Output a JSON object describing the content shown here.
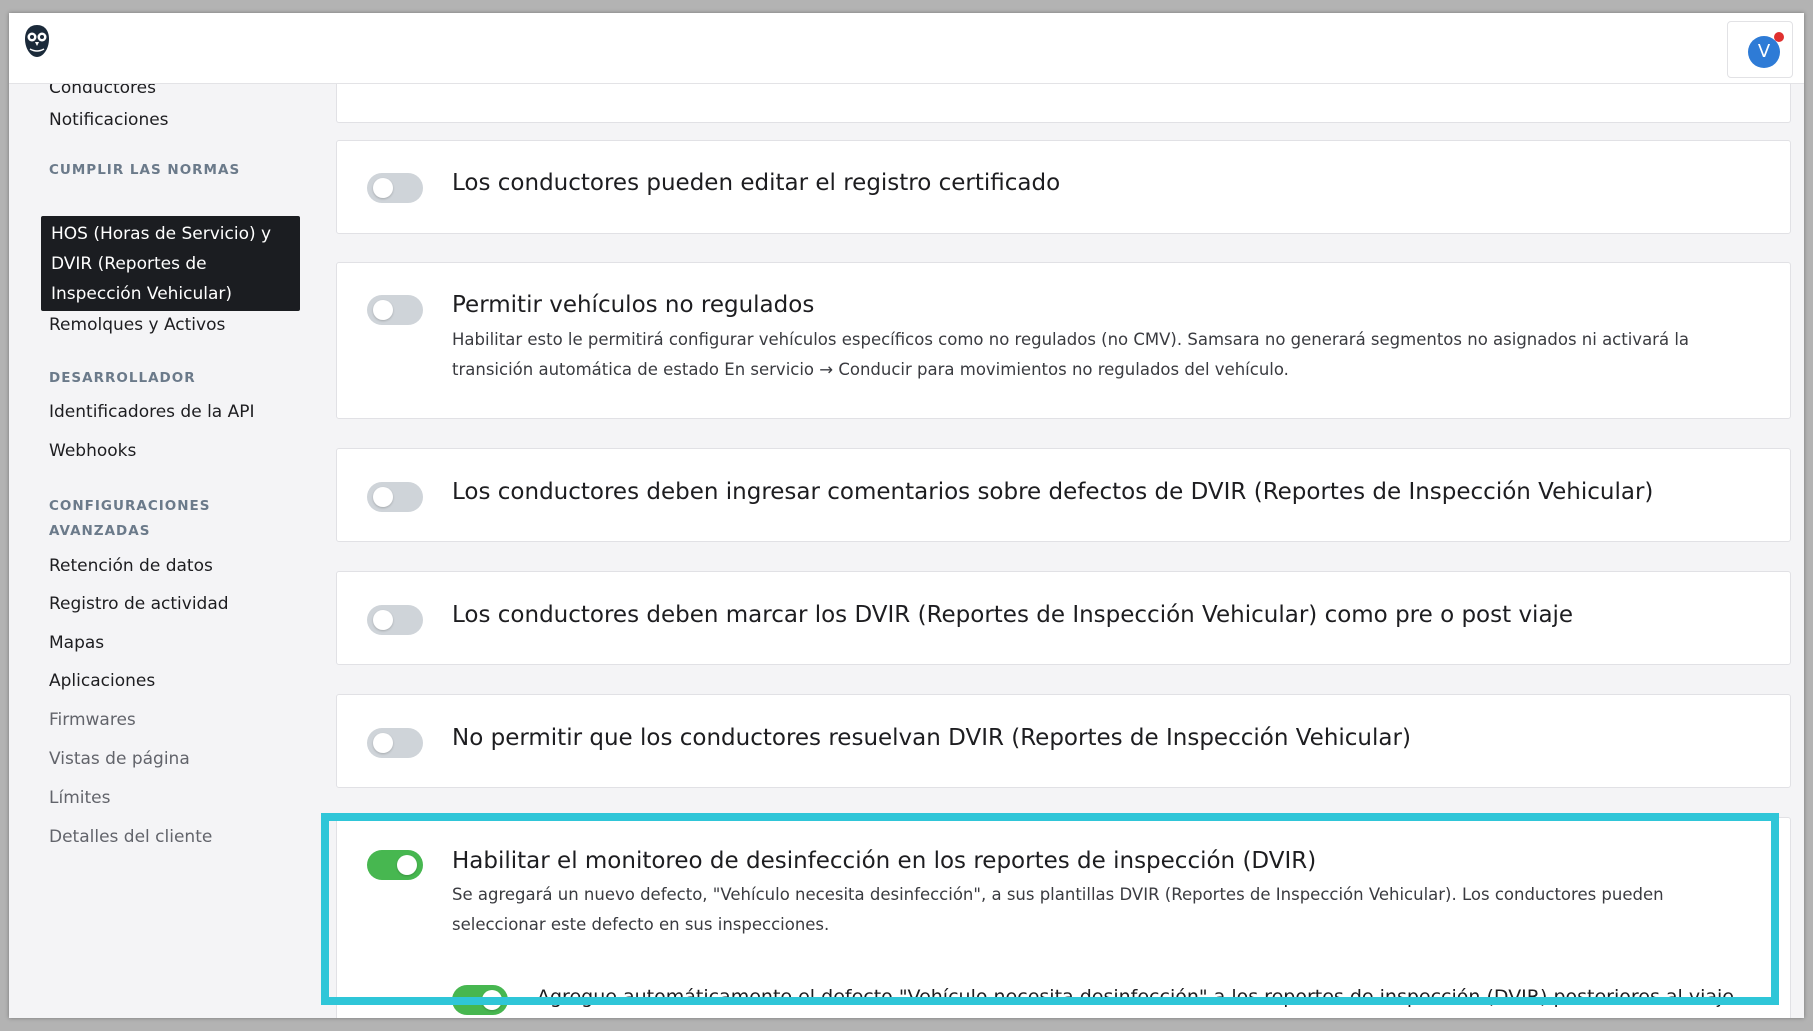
{
  "colors": {
    "accent_highlight": "#2fc6d8",
    "toggle_on": "#47b750",
    "toggle_off": "#cfd4d9",
    "avatar": "#2e7bd6",
    "notification_dot": "#e0302f"
  },
  "header": {
    "avatar_initial": "V"
  },
  "sidebar": {
    "items_top": [
      "Conductores",
      "Notificaciones"
    ],
    "section_compliance": "CUMPLIR LAS NORMAS",
    "active_item": "HOS (Horas de Servicio) y DVIR (Reportes de Inspección Vehicular)",
    "item_trailers": "Remolques y Activos",
    "section_developer": "DESARROLLADOR",
    "item_api": "Identificadores de la API",
    "item_webhooks": "Webhooks",
    "section_advanced": "CONFIGURACIONES AVANZADAS",
    "item_retention": "Retención de datos",
    "item_activity": "Registro de actividad",
    "item_maps": "Mapas",
    "item_apps": "Aplicaciones",
    "item_firmwares": "Firmwares",
    "item_pageviews": "Vistas de página",
    "item_limits": "Límites",
    "item_customer": "Detalles del cliente"
  },
  "settings": [
    {
      "title": "Los conductores pueden editar el registro certificado",
      "enabled": false
    },
    {
      "title": "Permitir vehículos no regulados",
      "description": "Habilitar esto le permitirá configurar vehículos específicos como no regulados (no CMV). Samsara no generará segmentos no asignados ni activará la transición automática de estado En servicio → Conducir para movimientos no regulados del vehículo.",
      "enabled": false
    },
    {
      "title": "Los conductores deben ingresar comentarios sobre defectos de DVIR (Reportes de Inspección Vehicular)",
      "enabled": false
    },
    {
      "title": "Los conductores deben marcar los DVIR (Reportes de Inspección Vehicular) como pre o post viaje",
      "enabled": false
    },
    {
      "title": "No permitir que los conductores resuelvan DVIR (Reportes de Inspección Vehicular)",
      "enabled": false
    },
    {
      "title": "Habilitar el monitoreo de desinfección en los reportes de inspección (DVIR)",
      "description": "Se agregará un nuevo defecto, \"Vehículo necesita desinfección\", a sus plantillas DVIR (Reportes de Inspección Vehicular). Los conductores pueden seleccionar este defecto en sus inspecciones.",
      "enabled": true,
      "sub_option": {
        "label": "Agregue automáticamente el defecto \"Vehículo necesita desinfección\" a los reportes de inspección (DVIR) posteriores al viaje",
        "enabled": true
      }
    }
  ]
}
